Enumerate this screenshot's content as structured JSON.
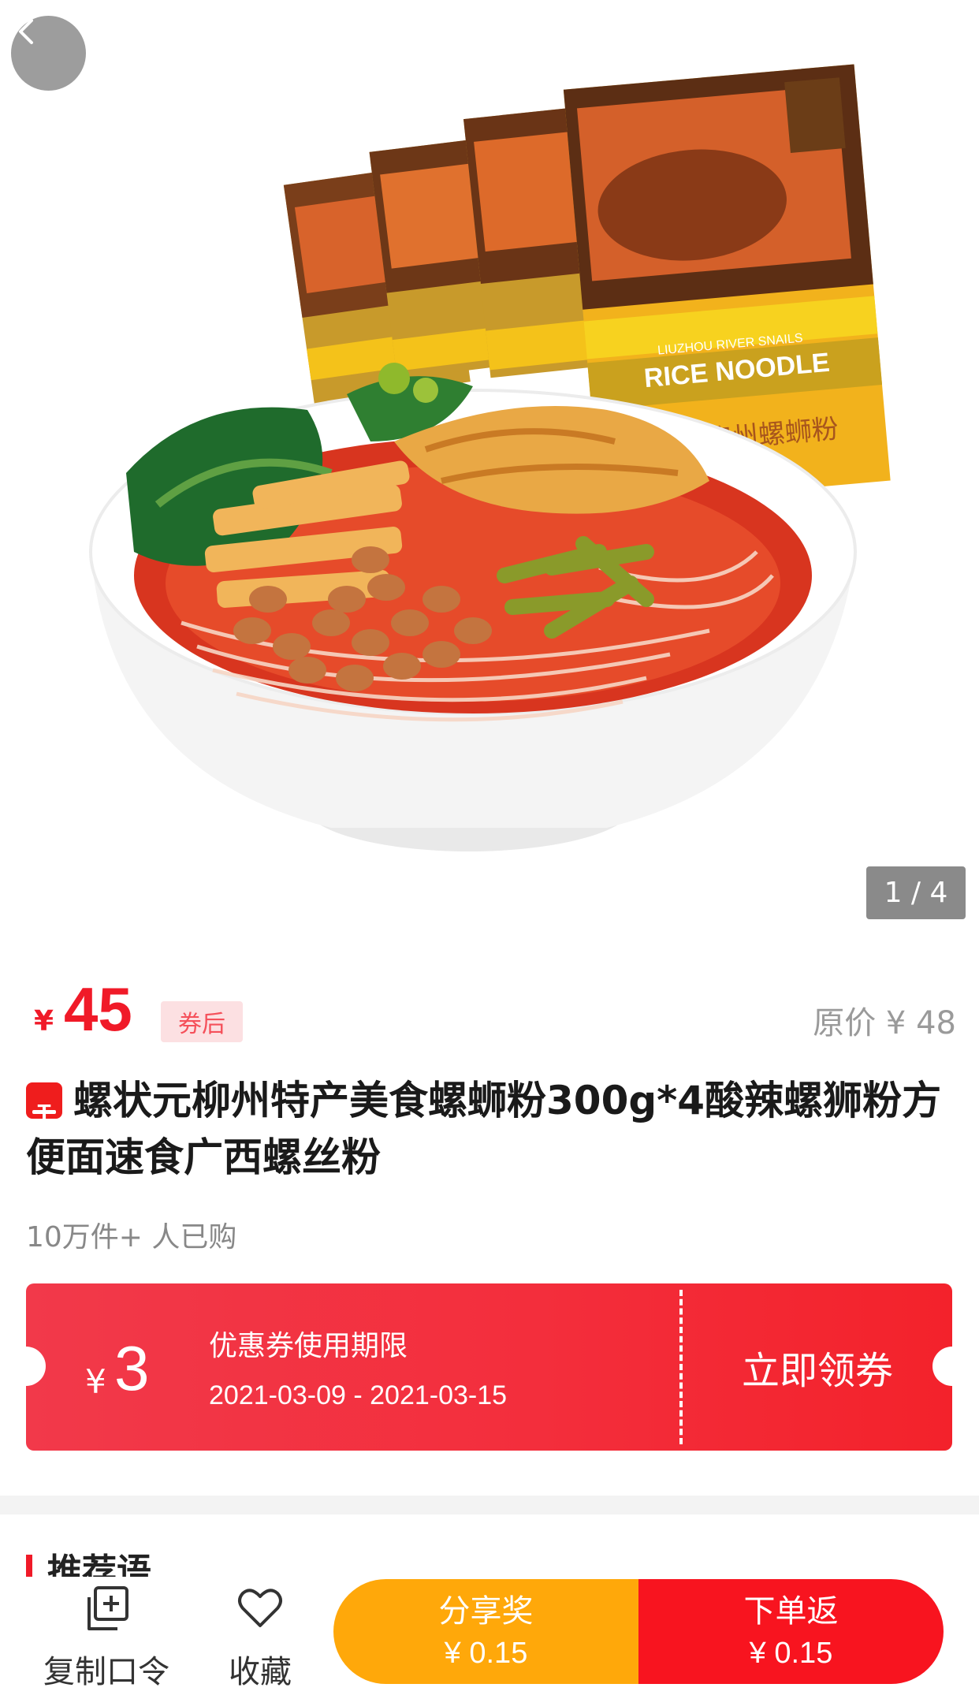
{
  "pager": "1 / 4",
  "price": {
    "currency": "¥",
    "amount": "45",
    "tag": "券后",
    "original": "原价 ¥ 48"
  },
  "product": {
    "title": "螺状元柳州特产美食螺蛳粉300g*4酸辣螺狮粉方便面速食广西螺丝粉",
    "sold": "10万件+ 人已购",
    "package_text_1": "LIUZHOU RIVER SNAILS",
    "package_text_2": "RICE NOODLE",
    "package_text_3": "柳州螺蛳粉"
  },
  "coupon": {
    "currency": "¥",
    "amount": "3",
    "title": "优惠券使用期限",
    "dates": "2021-03-09 - 2021-03-15",
    "claim_label": "立即领券"
  },
  "recommend": {
    "title": "推荐语"
  },
  "bottom_bar": {
    "copy_label": "复制口令",
    "favorite_label": "收藏",
    "share_title": "分享奖",
    "share_value": "¥ 0.15",
    "order_title": "下单返",
    "order_value": "¥ 0.15"
  },
  "colors": {
    "accent": "#f01a28",
    "share_button": "#ffa80a",
    "order_button": "#f8141f"
  },
  "icons": [
    "back-arrow-icon",
    "tmall-icon",
    "copy-icon",
    "heart-icon"
  ]
}
